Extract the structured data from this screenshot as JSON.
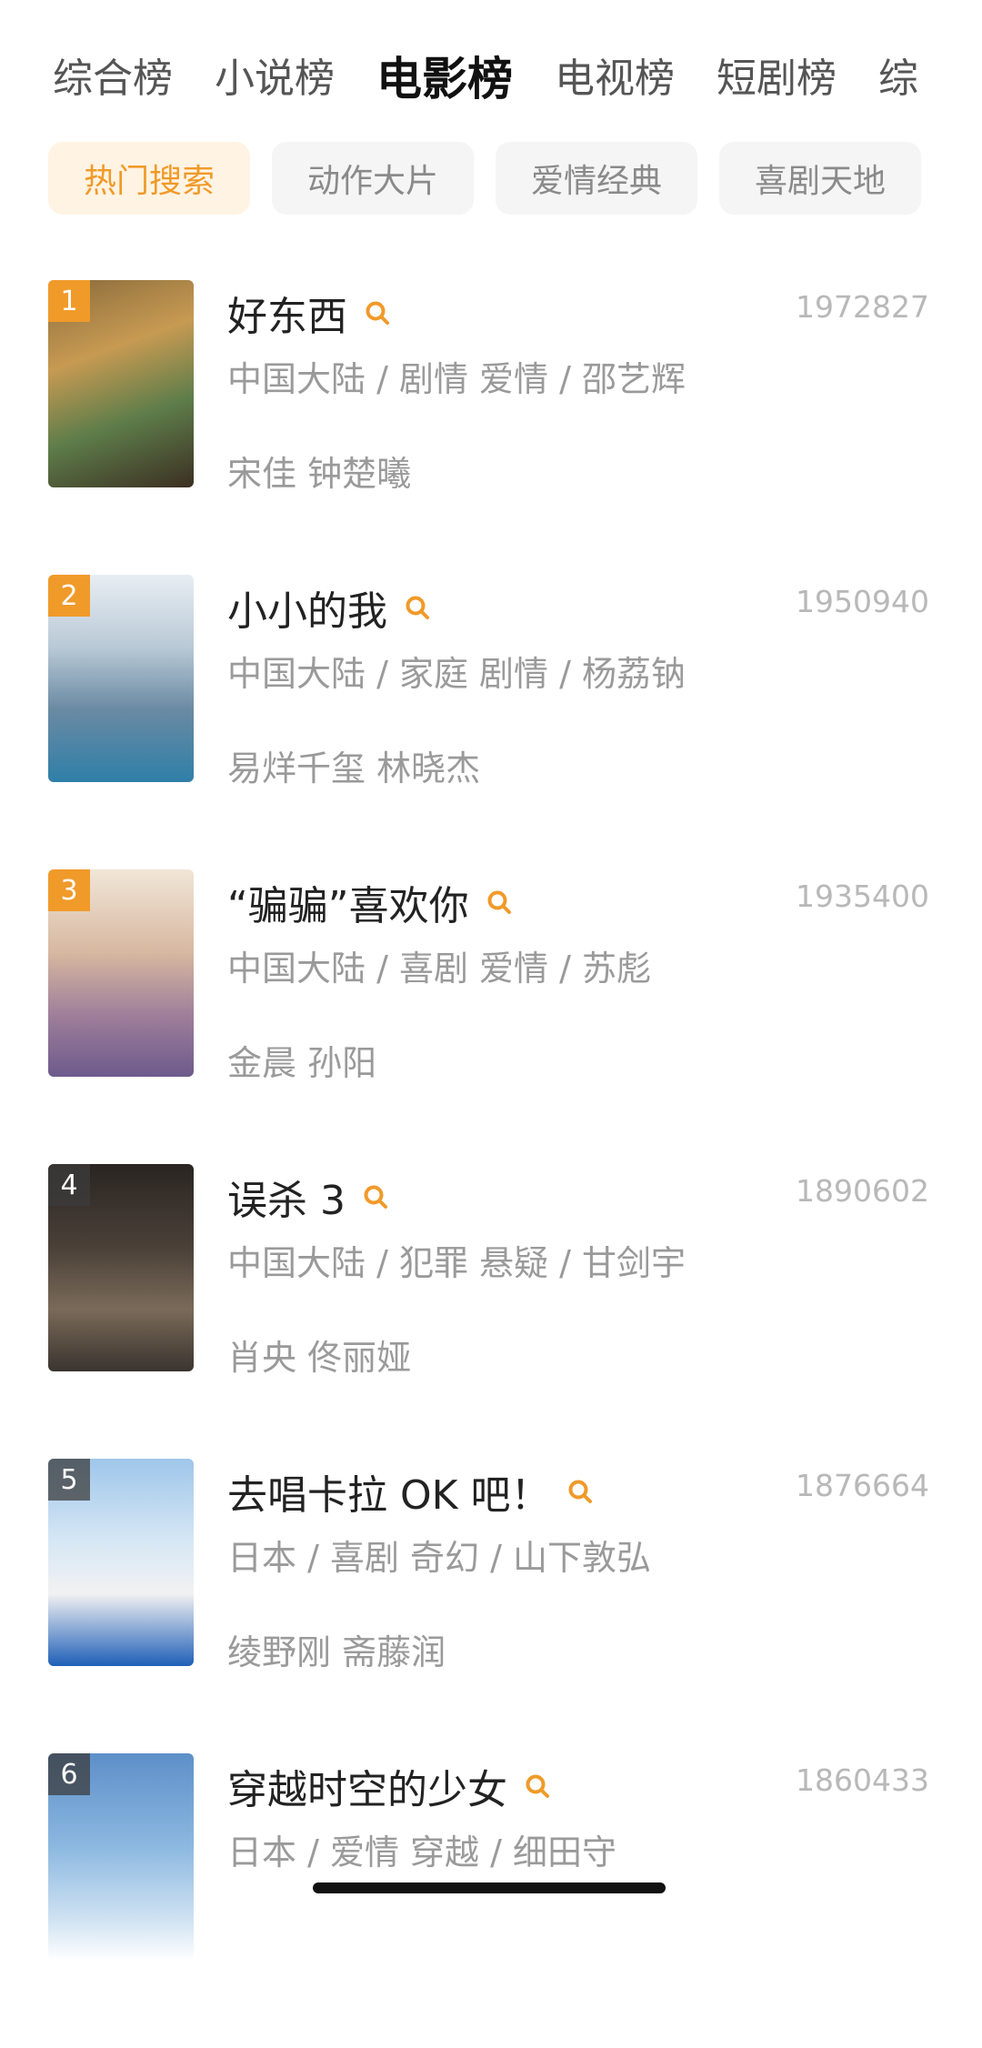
{
  "tabs": [
    "综合榜",
    "小说榜",
    "电影榜",
    "电视榜",
    "短剧榜",
    "综"
  ],
  "active_tab_index": 2,
  "chips": [
    "热门搜索",
    "动作大片",
    "爱情经典",
    "喜剧天地"
  ],
  "active_chip_index": 0,
  "colors": {
    "accent": "#f09a2a",
    "chip_active_bg": "#fff3e3",
    "muted": "#9a9a9a"
  },
  "items": [
    {
      "rank": "1",
      "title": "好东西",
      "count": "1972827",
      "meta": "中国大陆 / 剧情 爱情 / 邵艺辉",
      "cast": "宋佳 钟楚曦"
    },
    {
      "rank": "2",
      "title": "小小的我",
      "count": "1950940",
      "meta": "中国大陆 / 家庭 剧情 / 杨荔钠",
      "cast": "易烊千玺 林晓杰"
    },
    {
      "rank": "3",
      "title": "“骗骗”喜欢你",
      "count": "1935400",
      "meta": "中国大陆 / 喜剧 爱情 / 苏彪",
      "cast": "金晨 孙阳"
    },
    {
      "rank": "4",
      "title": "误杀 3",
      "count": "1890602",
      "meta": "中国大陆 / 犯罪 悬疑 / 甘剑宇",
      "cast": "肖央 佟丽娅"
    },
    {
      "rank": "5",
      "title": "去唱卡拉 OK 吧！",
      "count": "1876664",
      "meta": "日本 / 喜剧 奇幻 / 山下敦弘",
      "cast": "绫野刚 斋藤润"
    },
    {
      "rank": "6",
      "title": "穿越时空的少女",
      "count": "1860433",
      "meta": "日本 / 爱情 穿越 / 细田守",
      "cast": ""
    }
  ]
}
